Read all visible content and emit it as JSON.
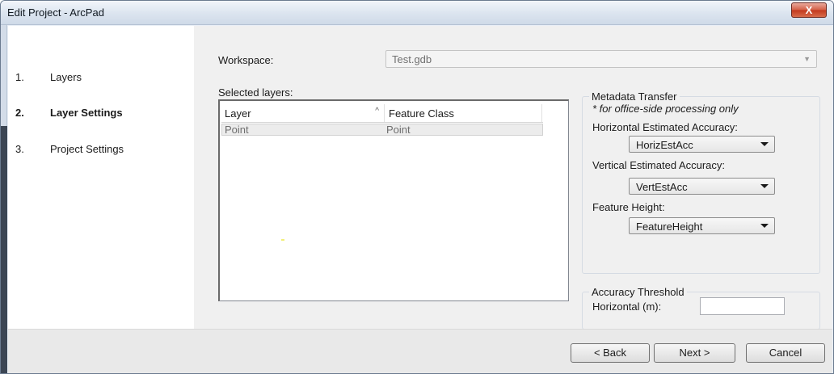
{
  "window": {
    "title": "Edit Project - ArcPad",
    "close_label": "X"
  },
  "nav": {
    "items": [
      {
        "num": "1.",
        "label": "Layers"
      },
      {
        "num": "2.",
        "label": "Layer Settings"
      },
      {
        "num": "3.",
        "label": "Project Settings"
      }
    ],
    "active_index": 1
  },
  "workspace": {
    "label": "Workspace:",
    "value": "Test.gdb"
  },
  "layers": {
    "label": "Selected layers:",
    "columns": [
      "Layer",
      "Feature Class"
    ],
    "rows": [
      [
        "Point",
        "Point"
      ]
    ]
  },
  "metadata": {
    "title": "Metadata Transfer",
    "note": "* for office-side processing only",
    "horizontal_label": "Horizontal Estimated Accuracy:",
    "horizontal_value": "HorizEstAcc",
    "vertical_label": "Vertical Estimated Accuracy:",
    "vertical_value": "VertEstAcc",
    "height_label": "Feature Height:",
    "height_value": "FeatureHeight"
  },
  "accuracy": {
    "title": "Accuracy Threshold",
    "horizontal_label": "Horizontal (m):",
    "horizontal_value": ""
  },
  "buttons": {
    "back": "< Back",
    "next": "Next >",
    "cancel": "Cancel"
  }
}
